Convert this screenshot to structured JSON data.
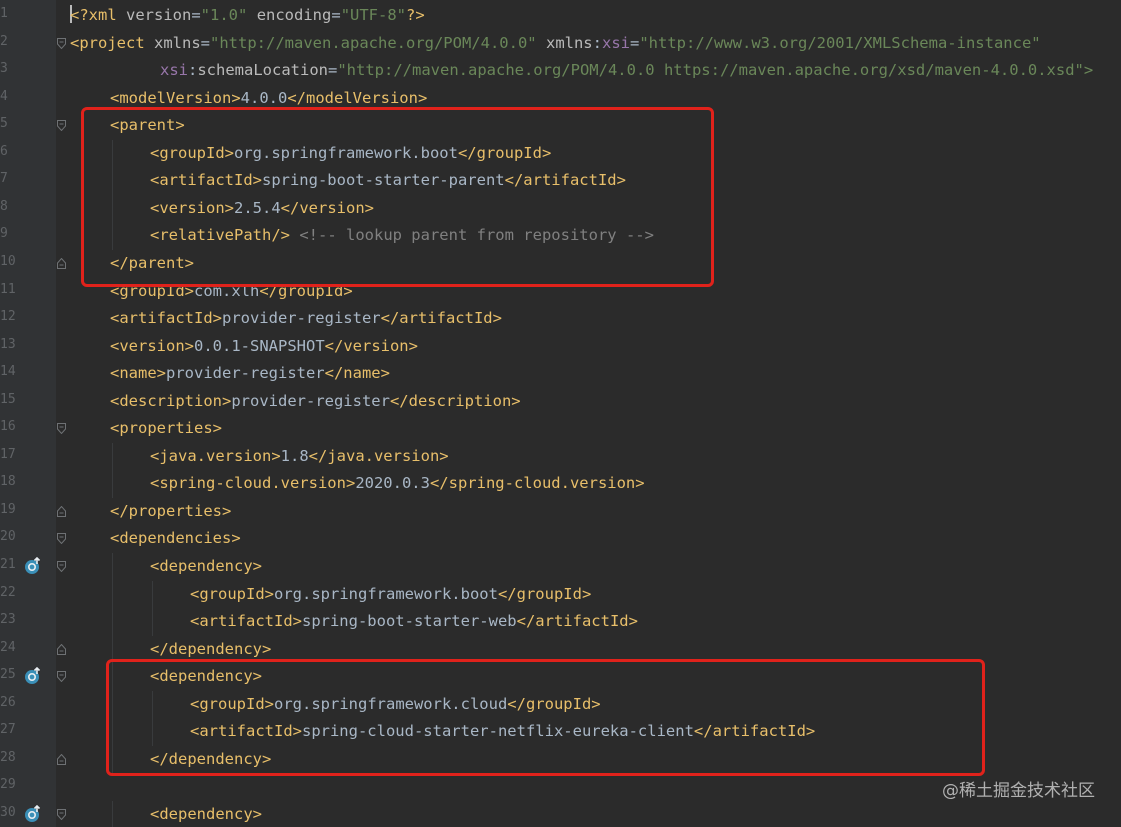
{
  "editor": {
    "file_language": "XML (Maven POM)",
    "colors": {
      "background": "#2b2b2b",
      "gutter": "#313335",
      "tag": "#e8bf6a",
      "attribute": "#bababa",
      "namespace": "#9876aa",
      "string": "#6a8759",
      "text": "#a9b7c6",
      "comment": "#808080",
      "highlight_box": "#e0221b"
    },
    "lines": [
      {
        "n": "1",
        "indent": 0,
        "caret": true,
        "fold": "",
        "maven_icon": false,
        "tokens": [
          {
            "c": "pi",
            "t": "<?xml "
          },
          {
            "c": "a",
            "t": "version"
          },
          {
            "c": "tx",
            "t": "="
          },
          {
            "c": "v",
            "t": "\"1.0\""
          },
          {
            "c": "tx",
            "t": " "
          },
          {
            "c": "a",
            "t": "encoding"
          },
          {
            "c": "tx",
            "t": "="
          },
          {
            "c": "v",
            "t": "\"UTF-8\""
          },
          {
            "c": "pi",
            "t": "?>"
          }
        ]
      },
      {
        "n": "2",
        "indent": 0,
        "fold": "open",
        "maven_icon": false,
        "tokens": [
          {
            "c": "t",
            "t": "<project "
          },
          {
            "c": "a",
            "t": "xmlns"
          },
          {
            "c": "tx",
            "t": "="
          },
          {
            "c": "v",
            "t": "\"http://maven.apache.org/POM/4.0.0\""
          },
          {
            "c": "tx",
            "t": " "
          },
          {
            "c": "a",
            "t": "xmlns"
          },
          {
            "c": "tx",
            "t": ":"
          },
          {
            "c": "ns",
            "t": "xsi"
          },
          {
            "c": "tx",
            "t": "="
          },
          {
            "c": "v",
            "t": "\"http://www.w3.org/2001/XMLSchema-instance\""
          }
        ]
      },
      {
        "n": "3",
        "indent": 0,
        "offset": 9,
        "fold": "",
        "maven_icon": false,
        "tokens": [
          {
            "c": "ns",
            "t": "xsi"
          },
          {
            "c": "tx",
            "t": ":"
          },
          {
            "c": "a",
            "t": "schemaLocation"
          },
          {
            "c": "tx",
            "t": "="
          },
          {
            "c": "v",
            "t": "\"http://maven.apache.org/POM/4.0.0 https://maven.apache.org/xsd/maven-4.0.0.xsd\">"
          }
        ]
      },
      {
        "n": "4",
        "indent": 1,
        "fold": "",
        "maven_icon": false,
        "tokens": [
          {
            "c": "t",
            "t": "<modelVersion>"
          },
          {
            "c": "tx",
            "t": "4.0.0"
          },
          {
            "c": "t",
            "t": "</modelVersion>"
          }
        ]
      },
      {
        "n": "5",
        "indent": 1,
        "fold": "open",
        "maven_icon": false,
        "tokens": [
          {
            "c": "t",
            "t": "<parent>"
          }
        ]
      },
      {
        "n": "6",
        "indent": 2,
        "fold": "",
        "maven_icon": false,
        "tokens": [
          {
            "c": "t",
            "t": "<groupId>"
          },
          {
            "c": "tx",
            "t": "org.springframework.boot"
          },
          {
            "c": "t",
            "t": "</groupId>"
          }
        ]
      },
      {
        "n": "7",
        "indent": 2,
        "fold": "",
        "maven_icon": false,
        "tokens": [
          {
            "c": "t",
            "t": "<artifactId>"
          },
          {
            "c": "tx",
            "t": "spring-boot-starter-parent"
          },
          {
            "c": "t",
            "t": "</artifactId>"
          }
        ]
      },
      {
        "n": "8",
        "indent": 2,
        "fold": "",
        "maven_icon": false,
        "tokens": [
          {
            "c": "t",
            "t": "<version>"
          },
          {
            "c": "tx",
            "t": "2.5.4"
          },
          {
            "c": "t",
            "t": "</version>"
          }
        ]
      },
      {
        "n": "9",
        "indent": 2,
        "fold": "",
        "maven_icon": false,
        "tokens": [
          {
            "c": "t",
            "t": "<relativePath/>"
          },
          {
            "c": "tx",
            "t": " "
          },
          {
            "c": "cm",
            "t": "<!-- lookup parent from repository -->"
          }
        ]
      },
      {
        "n": "10",
        "indent": 1,
        "fold": "close",
        "maven_icon": false,
        "tokens": [
          {
            "c": "t",
            "t": "</parent>"
          }
        ]
      },
      {
        "n": "11",
        "indent": 1,
        "fold": "",
        "maven_icon": false,
        "tokens": [
          {
            "c": "t",
            "t": "<groupId>"
          },
          {
            "c": "tx",
            "t": "com.xlh"
          },
          {
            "c": "t",
            "t": "</groupId>"
          }
        ]
      },
      {
        "n": "12",
        "indent": 1,
        "fold": "",
        "maven_icon": false,
        "tokens": [
          {
            "c": "t",
            "t": "<artifactId>"
          },
          {
            "c": "tx",
            "t": "provider-register"
          },
          {
            "c": "t",
            "t": "</artifactId>"
          }
        ]
      },
      {
        "n": "13",
        "indent": 1,
        "fold": "",
        "maven_icon": false,
        "tokens": [
          {
            "c": "t",
            "t": "<version>"
          },
          {
            "c": "tx",
            "t": "0.0.1-SNAPSHOT"
          },
          {
            "c": "t",
            "t": "</version>"
          }
        ]
      },
      {
        "n": "14",
        "indent": 1,
        "fold": "",
        "maven_icon": false,
        "tokens": [
          {
            "c": "t",
            "t": "<name>"
          },
          {
            "c": "tx",
            "t": "provider-register"
          },
          {
            "c": "t",
            "t": "</name>"
          }
        ]
      },
      {
        "n": "15",
        "indent": 1,
        "fold": "",
        "maven_icon": false,
        "tokens": [
          {
            "c": "t",
            "t": "<description>"
          },
          {
            "c": "tx",
            "t": "provider-register"
          },
          {
            "c": "t",
            "t": "</description>"
          }
        ]
      },
      {
        "n": "16",
        "indent": 1,
        "fold": "open",
        "maven_icon": false,
        "tokens": [
          {
            "c": "t",
            "t": "<properties>"
          }
        ]
      },
      {
        "n": "17",
        "indent": 2,
        "fold": "",
        "maven_icon": false,
        "tokens": [
          {
            "c": "t",
            "t": "<java.version>"
          },
          {
            "c": "tx",
            "t": "1.8"
          },
          {
            "c": "t",
            "t": "</java.version>"
          }
        ]
      },
      {
        "n": "18",
        "indent": 2,
        "fold": "",
        "maven_icon": false,
        "tokens": [
          {
            "c": "t",
            "t": "<spring-cloud.version>"
          },
          {
            "c": "tx",
            "t": "2020.0.3"
          },
          {
            "c": "t",
            "t": "</spring-cloud.version>"
          }
        ]
      },
      {
        "n": "19",
        "indent": 1,
        "fold": "close",
        "maven_icon": false,
        "tokens": [
          {
            "c": "t",
            "t": "</properties>"
          }
        ]
      },
      {
        "n": "20",
        "indent": 1,
        "fold": "open",
        "maven_icon": false,
        "tokens": [
          {
            "c": "t",
            "t": "<dependencies>"
          }
        ]
      },
      {
        "n": "21",
        "indent": 2,
        "fold": "open",
        "maven_icon": true,
        "tokens": [
          {
            "c": "t",
            "t": "<dependency>"
          }
        ]
      },
      {
        "n": "22",
        "indent": 3,
        "fold": "",
        "maven_icon": false,
        "tokens": [
          {
            "c": "t",
            "t": "<groupId>"
          },
          {
            "c": "tx",
            "t": "org.springframework.boot"
          },
          {
            "c": "t",
            "t": "</groupId>"
          }
        ]
      },
      {
        "n": "23",
        "indent": 3,
        "fold": "",
        "maven_icon": false,
        "tokens": [
          {
            "c": "t",
            "t": "<artifactId>"
          },
          {
            "c": "tx",
            "t": "spring-boot-starter-web"
          },
          {
            "c": "t",
            "t": "</artifactId>"
          }
        ]
      },
      {
        "n": "24",
        "indent": 2,
        "fold": "close",
        "maven_icon": false,
        "tokens": [
          {
            "c": "t",
            "t": "</dependency>"
          }
        ]
      },
      {
        "n": "25",
        "indent": 2,
        "fold": "open",
        "maven_icon": true,
        "tokens": [
          {
            "c": "t",
            "t": "<dependency>"
          }
        ]
      },
      {
        "n": "26",
        "indent": 3,
        "fold": "",
        "maven_icon": false,
        "tokens": [
          {
            "c": "t",
            "t": "<groupId>"
          },
          {
            "c": "tx",
            "t": "org.springframework.cloud"
          },
          {
            "c": "t",
            "t": "</groupId>"
          }
        ]
      },
      {
        "n": "27",
        "indent": 3,
        "fold": "",
        "maven_icon": false,
        "tokens": [
          {
            "c": "t",
            "t": "<artifactId>"
          },
          {
            "c": "tx",
            "t": "spring-cloud-starter-netflix-eureka-client"
          },
          {
            "c": "t",
            "t": "</artifactId>"
          }
        ]
      },
      {
        "n": "28",
        "indent": 2,
        "fold": "close",
        "maven_icon": false,
        "tokens": [
          {
            "c": "t",
            "t": "</dependency>"
          }
        ]
      },
      {
        "n": "29",
        "indent": 0,
        "fold": "",
        "maven_icon": false,
        "tokens": []
      },
      {
        "n": "30",
        "indent": 2,
        "fold": "open",
        "maven_icon": true,
        "tokens": [
          {
            "c": "t",
            "t": "<dependency>"
          }
        ]
      }
    ]
  },
  "watermark": {
    "text": "@稀土掘金技术社区"
  }
}
